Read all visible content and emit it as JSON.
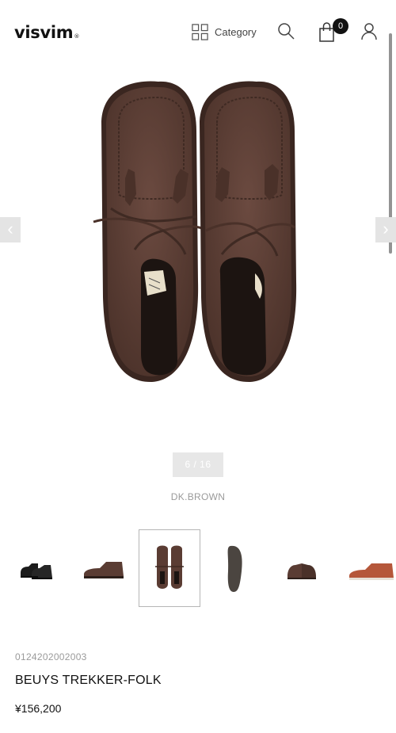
{
  "header": {
    "logo": "visvim",
    "logo_mark": "®",
    "category_label": "Category",
    "cart_count": "0"
  },
  "gallery": {
    "prev_label": "‹",
    "next_label": "›",
    "counter": "6 / 16",
    "color_name": "DK.BROWN",
    "thumbnails": [
      "black-side-pair",
      "brown-side-single",
      "brown-top-pair",
      "sole-bottom",
      "brown-front-pair",
      "tan-side-single"
    ],
    "active_thumbnail": 2
  },
  "product": {
    "sku": "0124202002003",
    "name": "BEUYS TREKKER-FOLK",
    "price": "¥156,200"
  },
  "colors": {
    "suede": "#5a3c33",
    "suede_dark": "#3f2a23",
    "accent": "#111111"
  }
}
